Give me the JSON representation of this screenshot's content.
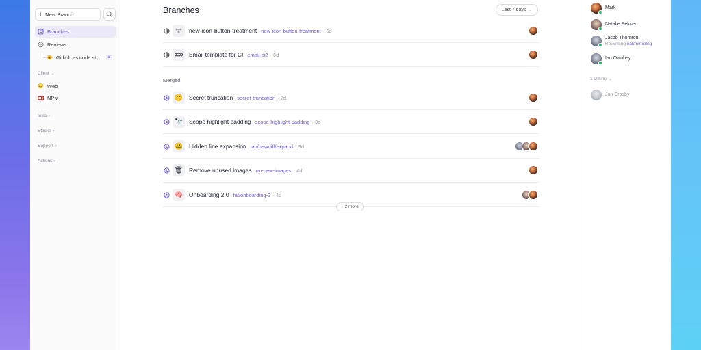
{
  "sidebar": {
    "new_branch_label": "New Branch",
    "items": [
      {
        "label": "Branches",
        "icon": "branches-icon"
      },
      {
        "label": "Reviews",
        "icon": "chat-bubble-icon"
      },
      {
        "label": "Github as code st...",
        "icon": "cat-face-emoji-icon",
        "badge": "3"
      }
    ],
    "client_label": "Client",
    "client_items": [
      {
        "label": "Web",
        "icon": "grinning-face-emoji-icon"
      },
      {
        "label": "NPM",
        "icon": "npm-logo-icon"
      }
    ],
    "sections": [
      "Infra",
      "Stacks",
      "Support",
      "Actions"
    ]
  },
  "main": {
    "title": "Branches",
    "range_label": "Last 7 days",
    "merged_label": "Merged",
    "more_label": "+ 2 more",
    "open_rows": [
      {
        "title": "new-icon-button-treatment",
        "branch": "new-icon-button-treatment",
        "age": "· 6d",
        "icon": "git-graph-icon"
      },
      {
        "title": "Email template for CI",
        "branch": "email-ci2",
        "age": "· 6d",
        "icon": "infinity-icon"
      }
    ],
    "merged_rows": [
      {
        "title": "Secret truncation",
        "branch": "secret-truncation",
        "age": "· 2d",
        "icon": "shushing-face-emoji-icon"
      },
      {
        "title": "Scope highlight padding",
        "branch": "scope-highlight-padding",
        "age": "· 3d",
        "icon": "telescope-emoji-icon"
      },
      {
        "title": "Hidden line expansion",
        "branch": "ian/newdiff/expand",
        "age": "· 3d",
        "icon": "zipper-face-emoji-icon"
      },
      {
        "title": "Remove unused images",
        "branch": "rm-new-images",
        "age": "· 4d",
        "icon": "wastebasket-emoji-icon"
      },
      {
        "title": "Onboarding 2.0",
        "branch": "fat/onboarding-2",
        "age": "· 4d",
        "icon": "brain-emoji-icon"
      }
    ]
  },
  "people": {
    "online": [
      {
        "name": "Mark",
        "sub": ""
      },
      {
        "name": "Natalie Pekker",
        "sub": ""
      },
      {
        "name": "Jacob Thornton",
        "sub_prefix": "Reviewing",
        "sub_link": "nat/mirroring"
      },
      {
        "name": "Ian Ownbey",
        "sub": ""
      }
    ],
    "offline_label": "1 Offline",
    "offline": [
      {
        "name": "Jon Crosby"
      }
    ]
  },
  "colors": {
    "accent": "#6b5bd6",
    "online": "#2fb96a"
  }
}
